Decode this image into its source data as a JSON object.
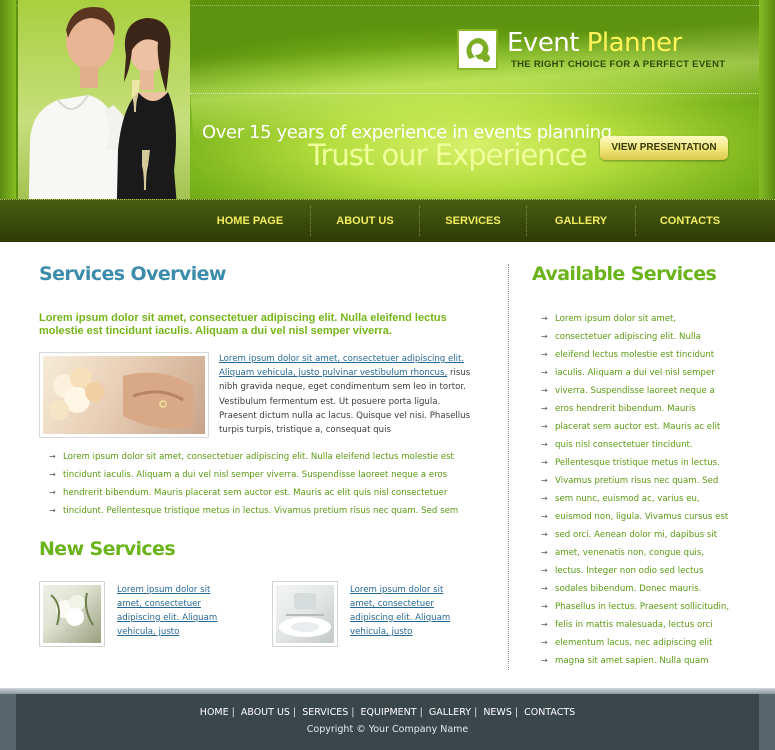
{
  "header": {
    "logo_word1": "Event",
    "logo_word2": "Planner",
    "tagline": "THE RIGHT CHOICE FOR A PERFECT EVENT",
    "experience": "Over 15 years of experience in events planning.",
    "trust": "Trust our Experience",
    "view_button": "VIEW PRESENTATION"
  },
  "nav": {
    "items": [
      "HOME PAGE",
      "ABOUT US",
      "SERVICES",
      "GALLERY",
      "CONTACTS"
    ]
  },
  "main": {
    "services_title": "Services Overview",
    "intro": "Lorem ipsum dolor sit amet, consectetuer adipiscing elit. Nulla eleifend lectus molestie est tincidunt iaculis. Aliquam a dui vel nisl semper viverra.",
    "para_link_1": "Lorem ipsum dolor sit amet, consectetuer adipiscing elit.",
    "para_link_2": "Aliquam vehicula, justo pulvinar vestibulum rhoncus,",
    "para_text": "risus nibh gravida neque, eget condimentum sem leo in tortor. Vestibulum fermentum est. Ut posuere porta ligula. Praesent dictum nulla ac lacus. Quisque vel nisi. Phasellus turpis turpis, tristique a, consequat quis",
    "bullets": [
      "Lorem ipsum dolor sit amet, consectetuer adipiscing elit. Nulla eleifend lectus molestie est",
      "tincidunt iaculis. Aliquam a dui vel nisl semper viverra. Suspendisse laoreet neque a eros",
      "hendrerit bibendum. Mauris placerat sem auctor est. Mauris ac elit quis nisl consectetuer",
      "tincidunt. Pellentesque tristique metus in lectus. Vivamus pretium risus nec quam. Sed sem"
    ],
    "new_title": "New Services",
    "new_items": [
      {
        "text": "Lorem ipsum dolor sit amet, consectetuer adipiscing elit. Aliquam vehicula, justo"
      },
      {
        "text": "Lorem ipsum dolor sit amet, consectetuer adipiscing elit. Aliquam vehicula, justo"
      }
    ]
  },
  "sidebar": {
    "title": "Available Services",
    "items": [
      "Lorem ipsum dolor sit amet,",
      "consectetuer adipiscing elit. Nulla",
      "eleifend lectus molestie est tincidunt",
      "iaculis. Aliquam a dui vel nisl semper",
      "viverra. Suspendisse laoreet neque a",
      "eros hendrerit bibendum. Mauris",
      "placerat sem auctor est. Mauris ac elit",
      "quis nisl consectetuer tincidunt.",
      "Pellentesque tristique metus in lectus.",
      "Vivamus pretium risus nec quam. Sed",
      "sem nunc, euismod ac, varius eu,",
      "euismod non, ligula. Vivamus cursus est",
      "sed orci. Aenean dolor mi, dapibus sit",
      "amet, venenatis non, congue quis,",
      "lectus. Integer non odio sed lectus",
      "sodales bibendum. Donec mauris.",
      "Phasellus in lectus. Praesent sollicitudin,",
      "felis in mattis malesuada, lectus orci",
      "elementum lacus, nec adipiscing elit",
      "magna sit amet sapien. Nulla quam"
    ]
  },
  "footer": {
    "links": [
      "HOME",
      "ABOUT US",
      "SERVICES",
      "EQUIPMENT",
      "GALLERY",
      "NEWS",
      "CONTACTS"
    ],
    "copyright": "Copyright © Your Company Name"
  },
  "icons": {
    "bullet": "arrow-bullet-icon",
    "logo": "leaf-logo-icon"
  },
  "colors": {
    "accent_green": "#6ab41a",
    "link_blue": "#276996",
    "title_blue": "#3d8cab",
    "nav_text": "#f3ef5e",
    "footer_bg": "#3b464b"
  }
}
